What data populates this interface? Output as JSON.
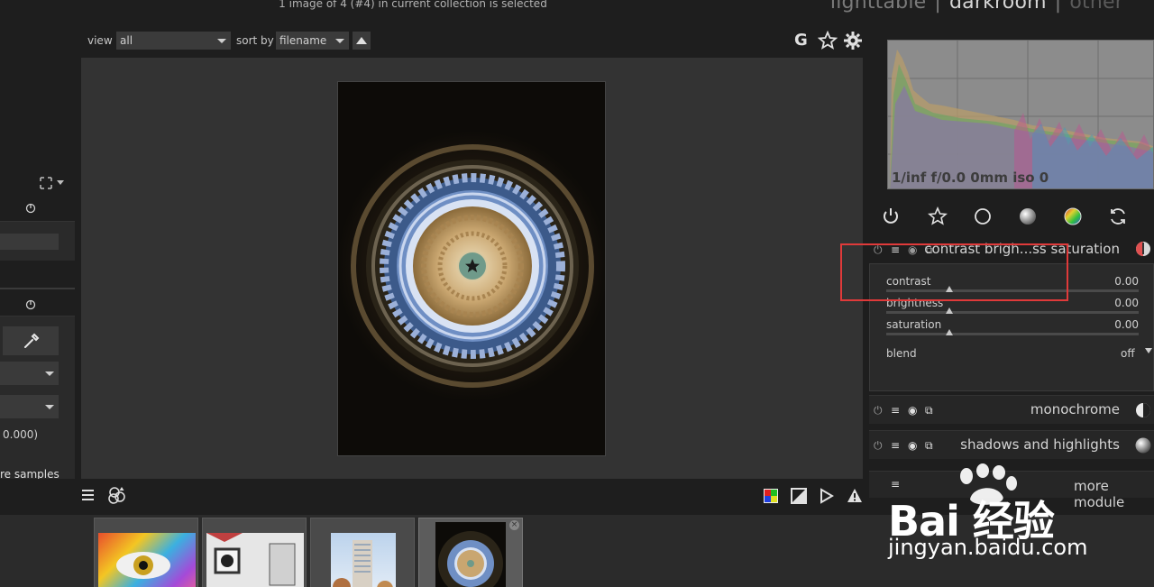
{
  "header": {
    "status": "1 image of 4 (#4) in current collection is selected",
    "views": [
      "lighttable",
      "darkroom",
      "other"
    ],
    "separator": "|"
  },
  "toolbar": {
    "view_label": "view",
    "view_value": "all",
    "sort_label": "sort by",
    "sort_value": "filename",
    "sort_dir_icon": "sort-ascending-icon",
    "right_icons": [
      "G",
      "star-icon",
      "gear-icon"
    ],
    "g_label": "G"
  },
  "left_panel": {
    "coords_text": "0.000)",
    "link_text": "re samples"
  },
  "right_panel": {
    "exif": "1/inf f/0.0 0mm iso 0",
    "group_icons": [
      "power-icon",
      "star-outline-icon",
      "circle-icon",
      "sphere-icon",
      "color-wheel-icon",
      "refresh-icon"
    ],
    "active_module": {
      "title": "contrast brigh...ss saturation",
      "sliders": [
        {
          "label": "contrast",
          "value": "0.00",
          "position": 0.5
        },
        {
          "label": "brightness",
          "value": "0.00",
          "position": 0.5
        },
        {
          "label": "saturation",
          "value": "0.00",
          "position": 0.5
        }
      ],
      "blend_label": "blend",
      "blend_value": "off"
    },
    "modules": [
      {
        "title": "monochrome"
      },
      {
        "title": "shadows and highlights"
      }
    ],
    "more_modules": "more module"
  },
  "bottom": {
    "left_icons": [
      "menu-icon",
      "styles-icon"
    ],
    "right_icons": [
      "color-checker-icon",
      "overexposed-icon",
      "softproof-icon",
      "gamut-warning-icon"
    ]
  },
  "watermark": {
    "brand": "Bai 经验",
    "url": "jingyan.baidu.com"
  },
  "colors": {
    "highlight": "#e03a3a",
    "background": "#1e1e1e",
    "center": "#333333"
  }
}
